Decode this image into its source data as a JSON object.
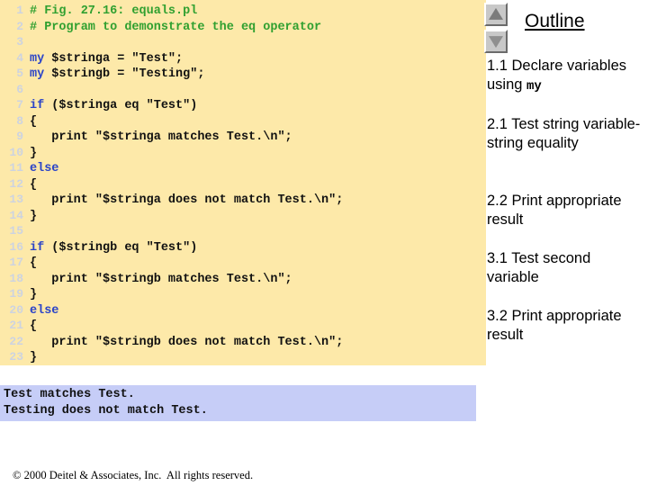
{
  "code": {
    "lines": [
      {
        "n": "1",
        "segments": [
          {
            "t": "# Fig. 27.16: equals.pl",
            "c": "cmt"
          }
        ]
      },
      {
        "n": "2",
        "segments": [
          {
            "t": "# Program to demonstrate the eq operator",
            "c": "cmt"
          }
        ]
      },
      {
        "n": "3",
        "segments": [
          {
            "t": "",
            "c": ""
          }
        ]
      },
      {
        "n": "4",
        "segments": [
          {
            "t": "my",
            "c": "kw"
          },
          {
            "t": " $stringa = \"Test\";",
            "c": ""
          }
        ]
      },
      {
        "n": "5",
        "segments": [
          {
            "t": "my",
            "c": "kw"
          },
          {
            "t": " $stringb = \"Testing\";",
            "c": ""
          }
        ]
      },
      {
        "n": "6",
        "segments": [
          {
            "t": "",
            "c": ""
          }
        ]
      },
      {
        "n": "7",
        "segments": [
          {
            "t": "if",
            "c": "kw"
          },
          {
            "t": " ($stringa eq \"Test\")",
            "c": ""
          }
        ]
      },
      {
        "n": "8",
        "segments": [
          {
            "t": "{",
            "c": ""
          }
        ]
      },
      {
        "n": "9",
        "segments": [
          {
            "t": "   print \"$stringa matches Test.\\n\";",
            "c": ""
          }
        ]
      },
      {
        "n": "10",
        "segments": [
          {
            "t": "}",
            "c": ""
          }
        ]
      },
      {
        "n": "11",
        "segments": [
          {
            "t": "else",
            "c": "kw"
          }
        ]
      },
      {
        "n": "12",
        "segments": [
          {
            "t": "{",
            "c": ""
          }
        ]
      },
      {
        "n": "13",
        "segments": [
          {
            "t": "   print \"$stringa does not match Test.\\n\";",
            "c": ""
          }
        ]
      },
      {
        "n": "14",
        "segments": [
          {
            "t": "}",
            "c": ""
          }
        ]
      },
      {
        "n": "15",
        "segments": [
          {
            "t": "",
            "c": ""
          }
        ]
      },
      {
        "n": "16",
        "segments": [
          {
            "t": "if",
            "c": "kw"
          },
          {
            "t": " ($stringb eq \"Test\")",
            "c": ""
          }
        ]
      },
      {
        "n": "17",
        "segments": [
          {
            "t": "{",
            "c": ""
          }
        ]
      },
      {
        "n": "18",
        "segments": [
          {
            "t": "   print \"$stringb matches Test.\\n\";",
            "c": ""
          }
        ]
      },
      {
        "n": "19",
        "segments": [
          {
            "t": "}",
            "c": ""
          }
        ]
      },
      {
        "n": "20",
        "segments": [
          {
            "t": "else",
            "c": "kw"
          }
        ]
      },
      {
        "n": "21",
        "segments": [
          {
            "t": "{",
            "c": ""
          }
        ]
      },
      {
        "n": "22",
        "segments": [
          {
            "t": "   print \"$stringb does not match Test.\\n\";",
            "c": ""
          }
        ]
      },
      {
        "n": "23",
        "segments": [
          {
            "t": "}",
            "c": ""
          }
        ]
      }
    ],
    "background_color": "#fde9a9",
    "keyword_color": "#2b44c8",
    "comment_color": "#30a030",
    "line_number_color": "#cdd3e0"
  },
  "output": {
    "background_color": "#c6cdf7",
    "lines": [
      "Test matches Test.",
      "Testing does not match Test."
    ]
  },
  "footer": {
    "text": "© 2000 Deitel & Associates, Inc.  All rights reserved."
  },
  "sidebar": {
    "title": "Outline",
    "scroll_up_icon": "triangle-up-icon",
    "scroll_down_icon": "triangle-down-icon",
    "items": [
      {
        "id": "item-0",
        "prefix": "1.1 Declare variables using ",
        "mono": "my",
        "suffix": ""
      },
      {
        "id": "item-1",
        "prefix": "2.1 Test string variable-string equality",
        "mono": "",
        "suffix": ""
      },
      {
        "id": "item-2",
        "prefix": "2.2 Print appropriate result",
        "mono": "",
        "suffix": ""
      },
      {
        "id": "item-3",
        "prefix": "3.1 Test second variable",
        "mono": "",
        "suffix": ""
      },
      {
        "id": "item-4",
        "prefix": "3.2 Print appropriate result",
        "mono": "",
        "suffix": ""
      }
    ]
  }
}
